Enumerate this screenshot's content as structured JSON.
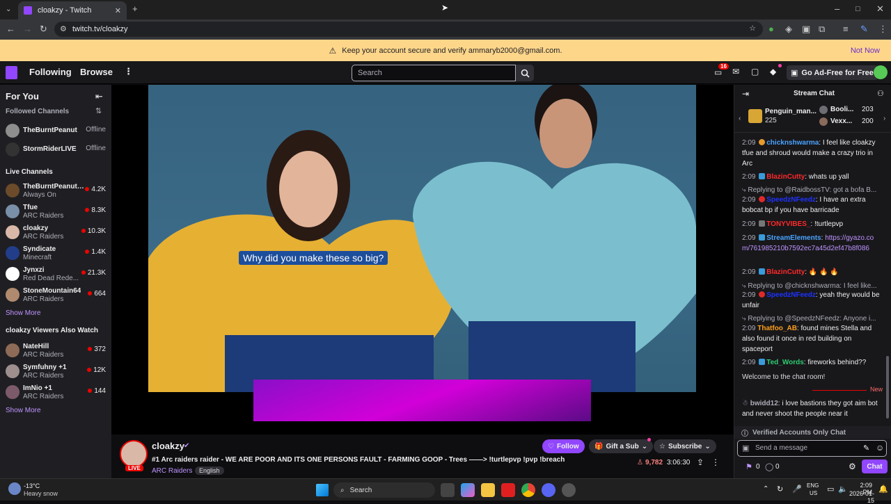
{
  "browser": {
    "tab_title": "cloakzy - Twitch",
    "url": "twitch.tv/cloakzy"
  },
  "banner": {
    "message": "Keep your account secure and verify ammaryb2000@gmail.com.",
    "dismiss": "Not Now"
  },
  "topnav": {
    "following": "Following",
    "browse": "Browse",
    "search_placeholder": "Search",
    "notif_count": "16",
    "ad_free": "Go Ad-Free for Free"
  },
  "sidebar": {
    "for_you": "For You",
    "followed_heading": "Followed Channels",
    "followed": [
      {
        "name": "TheBurntPeanut",
        "status": "Offline"
      },
      {
        "name": "StormRiderLIVE",
        "status": "Offline"
      }
    ],
    "live_heading": "Live Channels",
    "live": [
      {
        "name": "TheBurntPeanut_...",
        "game": "Always On",
        "viewers": "4.2K"
      },
      {
        "name": "Tfue",
        "game": "ARC Raiders",
        "viewers": "8.3K"
      },
      {
        "name": "cloakzy",
        "game": "ARC Raiders",
        "viewers": "10.3K"
      },
      {
        "name": "Syndicate",
        "game": "Minecraft",
        "viewers": "1.4K"
      },
      {
        "name": "Jynxzi",
        "game": "Red Dead Rede...",
        "viewers": "21.3K"
      },
      {
        "name": "StoneMountain64",
        "game": "ARC Raiders",
        "viewers": "664"
      }
    ],
    "show_more": "Show More",
    "also_watch_heading": "cloakzy Viewers Also Watch",
    "also_watch": [
      {
        "name": "NateHill",
        "game": "ARC Raiders",
        "viewers": "372"
      },
      {
        "name": "Symfuhny +1",
        "game": "ARC Raiders",
        "viewers": "12K"
      },
      {
        "name": "ImNio +1",
        "game": "ARC Raiders",
        "viewers": "144"
      }
    ]
  },
  "player": {
    "caption": "Why did you make these so big?"
  },
  "stream": {
    "channel": "cloakzy",
    "live_label": "LIVE",
    "title": "#1 Arc raiders raider - WE ARE POOR AND ITS ONE PERSONS FAULT - FARMING GOOP - Trees ——> !turtlepvp !pvp !breach",
    "category": "ARC Raiders",
    "tag": "English",
    "follow": "Follow",
    "gift": "Gift a Sub",
    "subscribe": "Subscribe",
    "viewers": "9,782",
    "uptime": "3:06:30"
  },
  "chat": {
    "title": "Stream Chat",
    "leaders": [
      {
        "name": "Penguin_man...",
        "points": "225"
      },
      {
        "name": "Booli...",
        "points": "203"
      },
      {
        "name": "Vexx...",
        "points": "200"
      }
    ],
    "messages": [
      {
        "time": "2:09",
        "user": "chicknshwarma",
        "color": "#1e90ff",
        "text": ": I feel like cloakzy tfue and shroud would make a crazy trio in Arc"
      },
      {
        "time": "2:09",
        "user": "BlazinCutty",
        "color": "#ff2a2a",
        "text": ": whats up yall"
      },
      {
        "reply": "Replying to @RaidbossTV: got a bofa B..."
      },
      {
        "time": "2:09",
        "user": "SpeedzNFeedz",
        "color": "#1e32ff",
        "text": ": I have an extra bobcat bp if you have barricade"
      },
      {
        "time": "2:09",
        "user": "TONYVIBES_",
        "color": "#ff2a2a",
        "text": ": !turtlepvp"
      },
      {
        "time": "2:09",
        "user": "StreamElements",
        "color": "#4aa3ff",
        "text": ":",
        "link": "https://gyazo.com/761985210b7592ec7a45d2ef47b8f086"
      },
      {
        "time": "2:09",
        "user": "BlazinCutty",
        "color": "#ff2a2a",
        "text": ": 🔥 🔥 🔥"
      },
      {
        "reply": "Replying to @chicknshwarma: I feel like..."
      },
      {
        "time": "2:09",
        "user": "SpeedzNFeedz",
        "color": "#1e32ff",
        "text": ": yeah they would be unfair"
      },
      {
        "reply": "Replying to @SpeedzNFeedz: Anyone i..."
      },
      {
        "time": "2:09",
        "user": "Thatfoo_AB",
        "color": "#ff9f1c",
        "text": ": found mines Stella and also found it once in red building on spaceport"
      },
      {
        "time": "2:09",
        "user": "Ted_Words",
        "color": "#2ecc71",
        "text": ": fireworks behind??"
      }
    ],
    "welcome": "Welcome to the chat room!",
    "new_label": "New",
    "last": {
      "user": "bwidd12",
      "text": ": i love bastions they got aim bot and never shoot the people near it"
    },
    "verified_notice": "Verified Accounts Only Chat",
    "input_placeholder": "Send a message",
    "points_a": "0",
    "points_b": "0",
    "chat_button": "Chat"
  },
  "taskbar": {
    "weather_temp": "-13°C",
    "weather_desc": "Heavy snow",
    "search": "Search",
    "lang": "ENG",
    "region": "US",
    "time": "2:09 PM",
    "date": "2026-01-15"
  }
}
